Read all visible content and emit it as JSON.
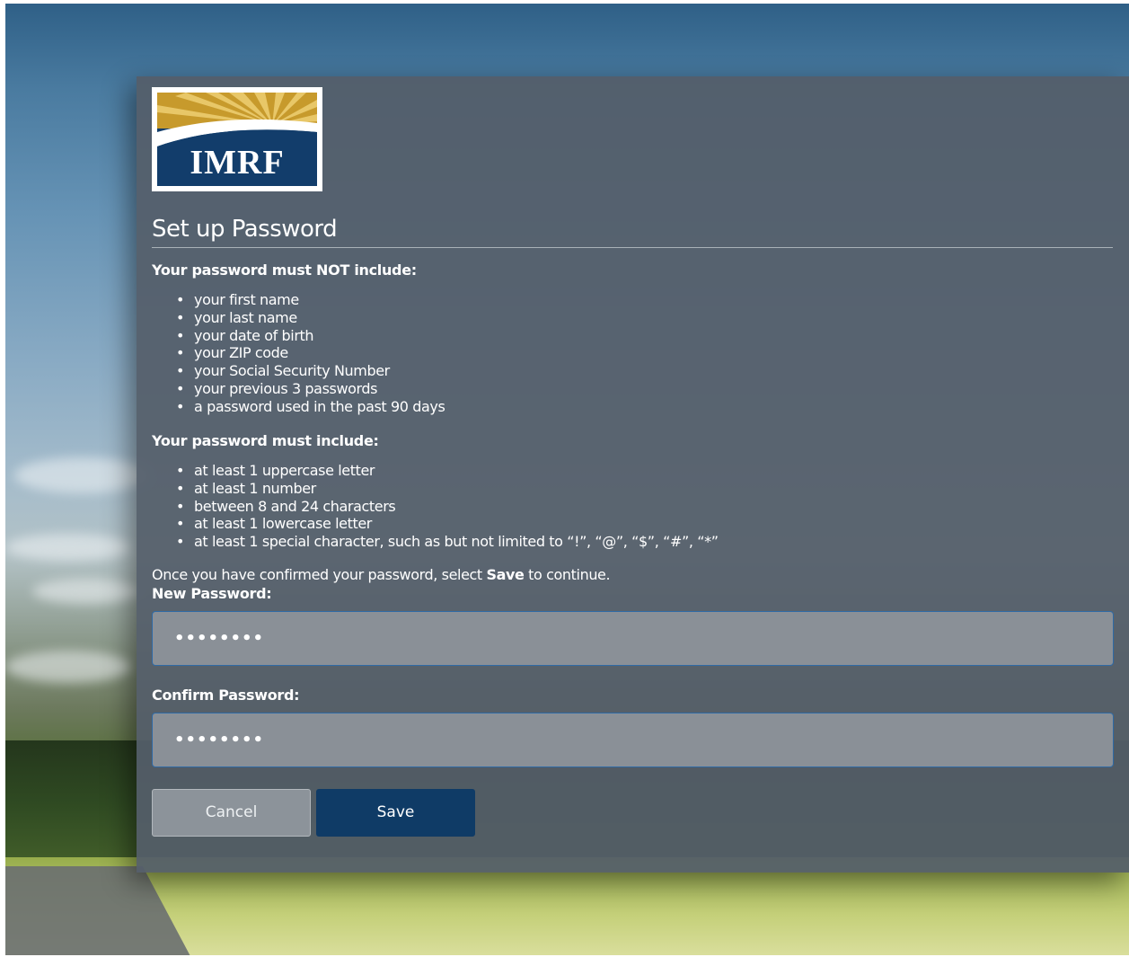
{
  "logo": {
    "text": "IMRF",
    "colors": {
      "navy": "#123d6b",
      "gold": "#c79a2c",
      "light_gold": "#e8c768"
    }
  },
  "page": {
    "title": "Set up Password"
  },
  "must_not_include": {
    "heading": "Your password must NOT include:",
    "items": [
      "your first name",
      "your last name",
      "your date of birth",
      "your ZIP code",
      "your Social Security Number",
      "your previous 3 passwords",
      "a password used in the past 90 days"
    ]
  },
  "must_include": {
    "heading": "Your password must include:",
    "items": [
      "at least 1 uppercase letter",
      "at least 1 number",
      "between 8 and 24 characters",
      "at least 1 lowercase letter",
      "at least 1 special character, such as but not limited to “!”, “@”, “$”, “#”, “*”"
    ]
  },
  "instruction": {
    "before": "Once you have confirmed your password, select ",
    "emphasis": "Save",
    "after": " to continue."
  },
  "form": {
    "new_password": {
      "label": "New Password:",
      "value": "••••••••"
    },
    "confirm_password": {
      "label": "Confirm Password:",
      "value": "••••••••"
    }
  },
  "buttons": {
    "cancel": "Cancel",
    "save": "Save"
  },
  "colors": {
    "panel": "#545e69",
    "save_button": "#0f3b66",
    "input_border": "#2f6aa5"
  }
}
